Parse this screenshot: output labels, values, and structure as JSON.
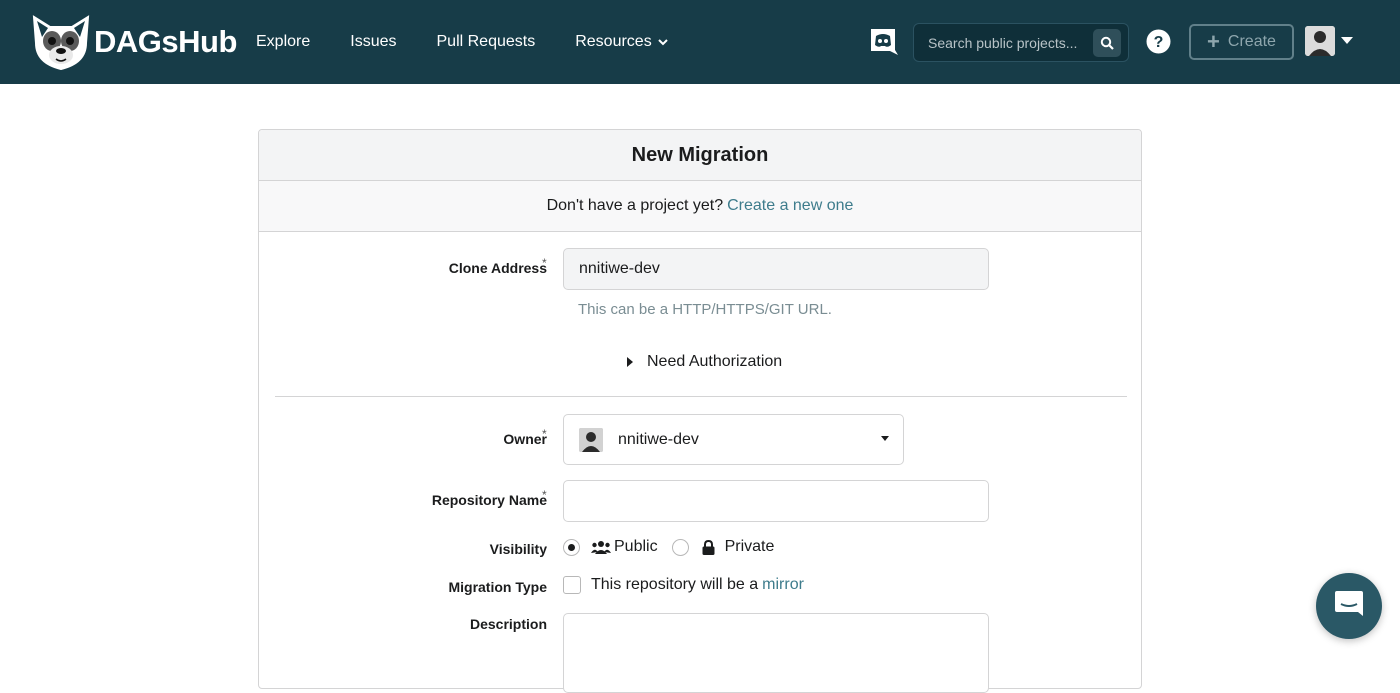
{
  "navbar": {
    "logo_text": "DAGsHub",
    "links": [
      "Explore",
      "Issues",
      "Pull Requests",
      "Resources"
    ],
    "search_placeholder": "Search public projects...",
    "create_label": "Create",
    "bg_color": "#173c48"
  },
  "card": {
    "title": "New Migration",
    "subtitle_text": "Don't have a project yet?",
    "subtitle_link": "Create a new one"
  },
  "form": {
    "clone_address_label": "Clone Address",
    "clone_address_value": "nnitiwe-dev",
    "clone_address_hint": "This can be a HTTP/HTTPS/GIT URL.",
    "need_authorization": "Need Authorization",
    "owner_label": "Owner",
    "owner_value": "nnitiwe-dev",
    "repo_name_label": "Repository Name",
    "repo_name_value": "",
    "visibility_label": "Visibility",
    "visibility_public": "Public",
    "visibility_private": "Private",
    "visibility_selected": "Public",
    "migration_type_label": "Migration Type",
    "migration_type_text": "This repository will be a",
    "migration_type_link": "mirror",
    "description_label": "Description",
    "required_mark": "*"
  }
}
